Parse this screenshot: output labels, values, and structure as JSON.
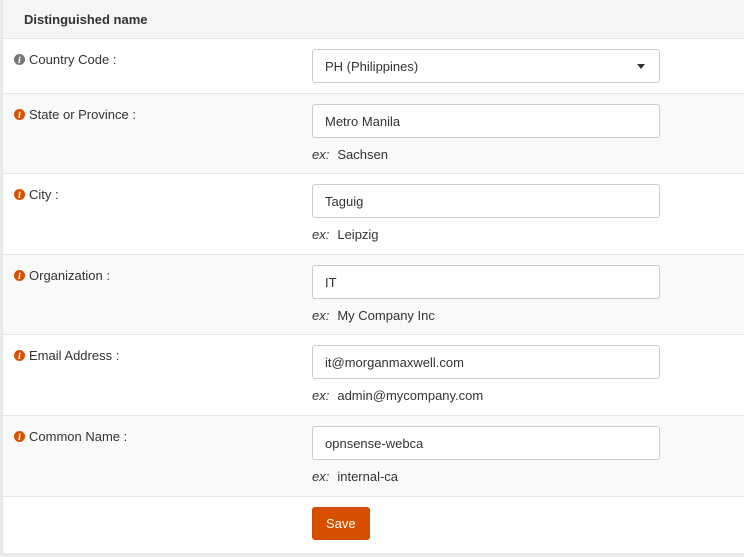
{
  "section": {
    "title": "Distinguished name"
  },
  "colors": {
    "accent": "#d94f00",
    "info_icon_grey": "#777777",
    "info_icon_orange": "#d94f00"
  },
  "fields": {
    "country": {
      "label": "Country Code :",
      "value": "PH (Philippines)",
      "icon": "info-icon"
    },
    "state": {
      "label": "State or Province :",
      "value": "Metro Manila",
      "hint_prefix": "ex:",
      "hint": "Sachsen",
      "icon": "info-icon"
    },
    "city": {
      "label": "City :",
      "value": "Taguig",
      "hint_prefix": "ex:",
      "hint": "Leipzig",
      "icon": "info-icon"
    },
    "organization": {
      "label": "Organization :",
      "value": "IT",
      "hint_prefix": "ex:",
      "hint": "My Company Inc",
      "icon": "info-icon"
    },
    "email": {
      "label": "Email Address :",
      "value": "it@morganmaxwell.com",
      "hint_prefix": "ex:",
      "hint": "admin@mycompany.com",
      "icon": "info-icon"
    },
    "common_name": {
      "label": "Common Name :",
      "value": "opnsense-webca",
      "hint_prefix": "ex:",
      "hint": "internal-ca",
      "icon": "info-icon"
    }
  },
  "actions": {
    "save_label": "Save"
  }
}
